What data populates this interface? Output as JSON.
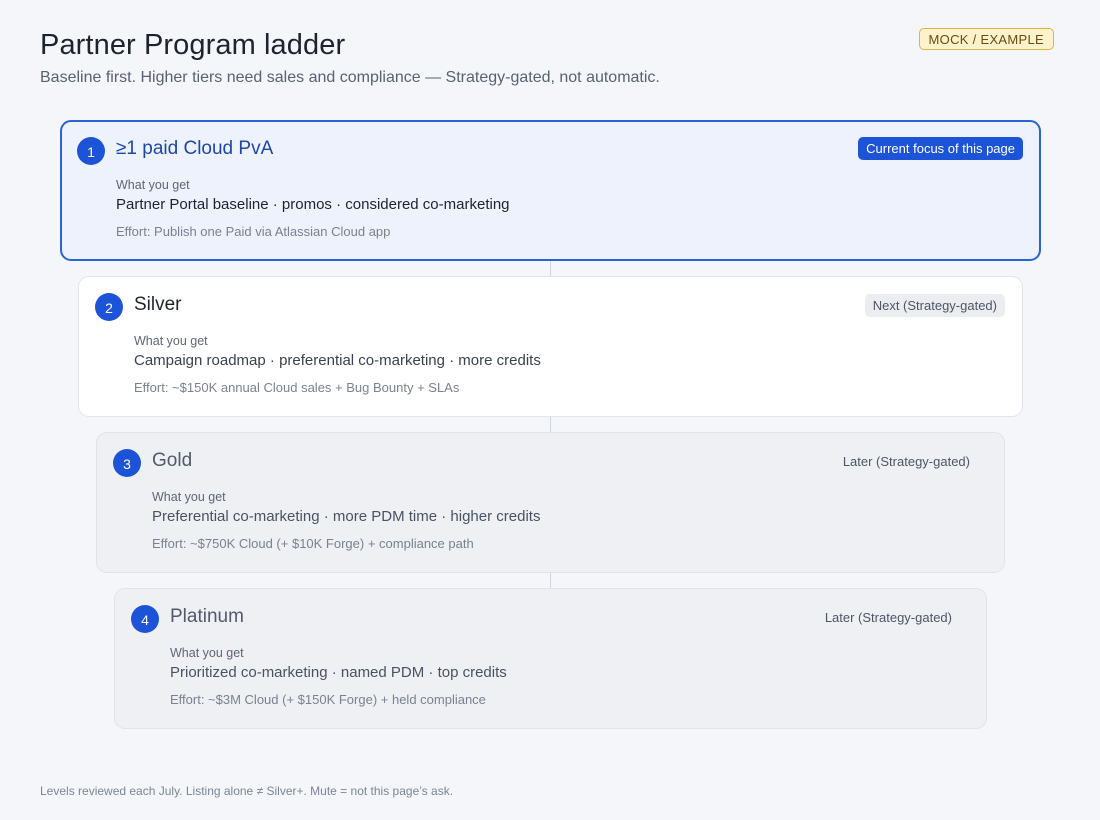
{
  "header": {
    "title": "Partner Program ladder",
    "subtitle": "Baseline first. Higher tiers need sales and compliance — Strategy-gated, not automatic.",
    "badge": "MOCK / EXAMPLE"
  },
  "colors": {
    "accent": "#1d53d6",
    "current_card_bg": "#edf2fd",
    "muted_card_bg": "#eef0f4",
    "mock_badge_bg": "#fcf2cc"
  },
  "tiers": [
    {
      "step": "1",
      "name": "≥1 paid Cloud PvA",
      "status": "Current focus of this page",
      "get_label": "What you get",
      "benefits": "Partner Portal baseline · promos · considered co-marketing",
      "effort": "Effort: Publish one Paid via Atlassian Cloud app"
    },
    {
      "step": "2",
      "name": "Silver",
      "status": "Next (Strategy-gated)",
      "get_label": "What you get",
      "benefits": "Campaign roadmap · preferential co-marketing · more credits",
      "effort": "Effort: ~$150K annual Cloud sales + Bug Bounty + SLAs"
    },
    {
      "step": "3",
      "name": "Gold",
      "status": "Later (Strategy-gated)",
      "get_label": "What you get",
      "benefits": "Preferential co-marketing · more PDM time · higher credits",
      "effort": "Effort: ~$750K Cloud (+ $10K Forge) + compliance path"
    },
    {
      "step": "4",
      "name": "Platinum",
      "status": "Later (Strategy-gated)",
      "get_label": "What you get",
      "benefits": "Prioritized co-marketing · named PDM · top credits",
      "effort": "Effort: ~$3M Cloud (+ $150K Forge) + held compliance"
    }
  ],
  "footer": {
    "note": "Levels reviewed each July. Listing alone ≠ Silver+. Mute = not this page’s ask."
  }
}
